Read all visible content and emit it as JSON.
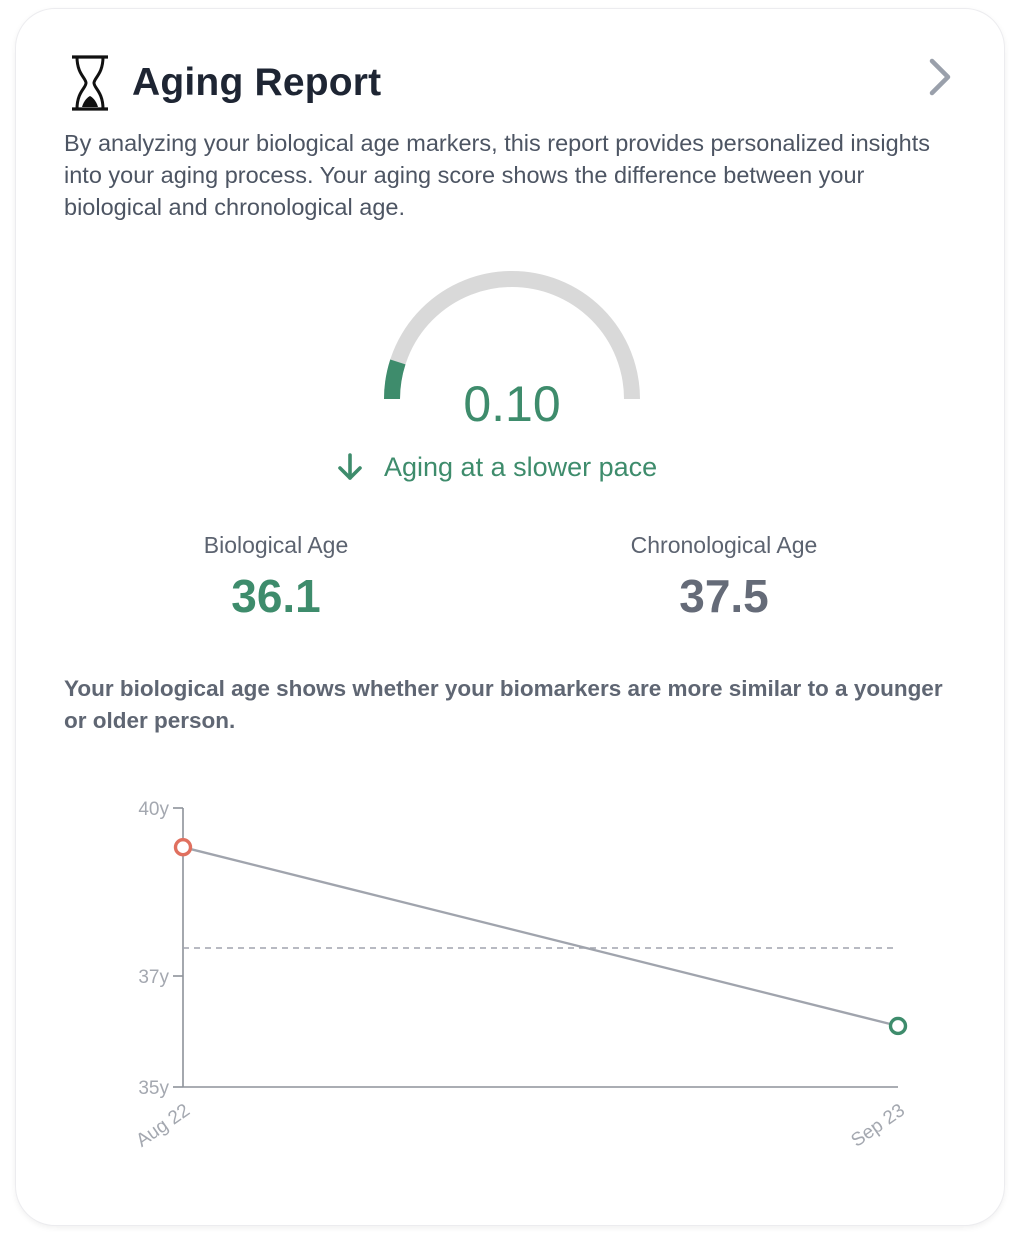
{
  "card": {
    "title": "Aging Report",
    "title_icon": "hourglass-icon",
    "nav_icon": "chevron-right-icon",
    "description": "By analyzing your biological age markers, this report provides personalized insights into your aging process. Your aging score shows the difference between your biological and chronological age."
  },
  "gauge": {
    "score": "0.10",
    "fill_fraction": 0.1,
    "pace_icon": "arrow-down-icon",
    "pace_text": "Aging at a slower pace"
  },
  "stats": {
    "biological_label": "Biological Age",
    "biological_value": "36.1",
    "chronological_label": "Chronological Age",
    "chronological_value": "37.5"
  },
  "note": "Your biological age shows whether your biomarkers are more similar to a younger or older person.",
  "colors": {
    "accent_green": "#3e8c6c",
    "point_red": "#e0705f",
    "gauge_track": "#d9d9d9",
    "line_gray": "#a0a4ad"
  },
  "chart_data": {
    "type": "line",
    "x": [
      "Aug 22",
      "Sep 23"
    ],
    "series": [
      {
        "values": [
          39.3,
          36.1
        ],
        "point_colors": [
          "#e0705f",
          "#3e8c6c"
        ]
      }
    ],
    "reference_line": 37.5,
    "yticks": [
      {
        "value": 40,
        "label": "40y"
      },
      {
        "value": 37,
        "label": "37y"
      },
      {
        "value": 35,
        "label": "35y"
      }
    ],
    "ylim": [
      35,
      40
    ],
    "grid": false
  }
}
